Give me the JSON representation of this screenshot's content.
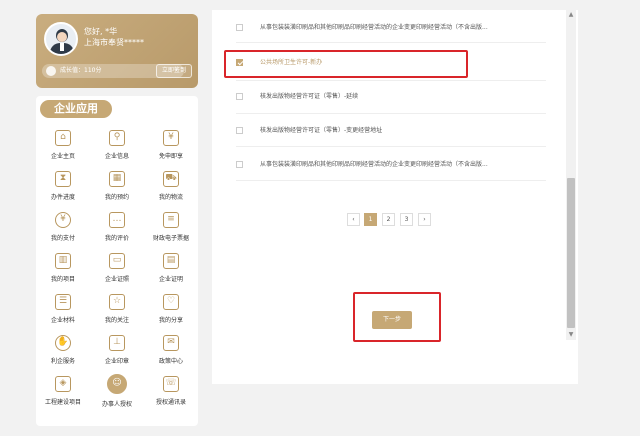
{
  "user": {
    "greeting": "您好, *华",
    "district": "上海市奉贤*****",
    "level_label": "成长值：110分",
    "sign_button": "立即签到"
  },
  "apps": {
    "title": "企业应用",
    "items": [
      {
        "label": "企业主页",
        "icon": "home-icon",
        "glyph": "⌂"
      },
      {
        "label": "企业信息",
        "icon": "company-info-icon",
        "glyph": "⚲"
      },
      {
        "label": "免申即享",
        "icon": "benefit-icon",
        "glyph": "¥"
      },
      {
        "label": "办件进度",
        "icon": "hourglass-icon",
        "glyph": "⧗"
      },
      {
        "label": "我的预约",
        "icon": "calendar-icon",
        "glyph": "▦"
      },
      {
        "label": "我的物流",
        "icon": "truck-icon",
        "glyph": "⛟"
      },
      {
        "label": "我的支付",
        "icon": "payment-icon",
        "glyph": "¥"
      },
      {
        "label": "我的评价",
        "icon": "comment-icon",
        "glyph": "…"
      },
      {
        "label": "财政电子票据",
        "icon": "receipt-icon",
        "glyph": "≡"
      },
      {
        "label": "我的项目",
        "icon": "books-icon",
        "glyph": "▥"
      },
      {
        "label": "企业证照",
        "icon": "license-icon",
        "glyph": "▭"
      },
      {
        "label": "企业证明",
        "icon": "certificate-icon",
        "glyph": "▤"
      },
      {
        "label": "企业材料",
        "icon": "document-icon",
        "glyph": "☰"
      },
      {
        "label": "我的关注",
        "icon": "follow-icon",
        "glyph": "☆"
      },
      {
        "label": "我的分享",
        "icon": "share-icon",
        "glyph": "♡"
      },
      {
        "label": "利企服务",
        "icon": "service-icon",
        "glyph": "✋"
      },
      {
        "label": "企业印章",
        "icon": "seal-icon",
        "glyph": "⊥"
      },
      {
        "label": "政策中心",
        "icon": "policy-icon",
        "glyph": "✉"
      },
      {
        "label": "工程建设项目",
        "icon": "construction-icon",
        "glyph": "◈"
      },
      {
        "label": "办事人授权",
        "icon": "authorize-person-icon",
        "glyph": "☺"
      },
      {
        "label": "授权通讯录",
        "icon": "contacts-icon",
        "glyph": "☏"
      }
    ]
  },
  "list": {
    "items": [
      {
        "text": "从事包装装潢印刷品和其他印刷品印刷经营活动的企业变更印刷经营活动（不含出版...",
        "checked": false
      },
      {
        "text": "公共场所卫生许可-新办",
        "checked": true
      },
      {
        "text": "核发出版物经营许可证（零售）-延续",
        "checked": false
      },
      {
        "text": "核发出版物经营许可证（零售）-变更经营地址",
        "checked": false
      },
      {
        "text": "从事包装装潢印刷品和其他印刷品印刷经营活动的企业变更印刷经营活动（不含出版...",
        "checked": false
      }
    ]
  },
  "pagination": {
    "prev": "‹",
    "pages": [
      "1",
      "2",
      "3"
    ],
    "current": "1",
    "next": "›"
  },
  "next_button": "下一步",
  "colors": {
    "accent": "#c6a875",
    "highlight": "#d9252a"
  }
}
